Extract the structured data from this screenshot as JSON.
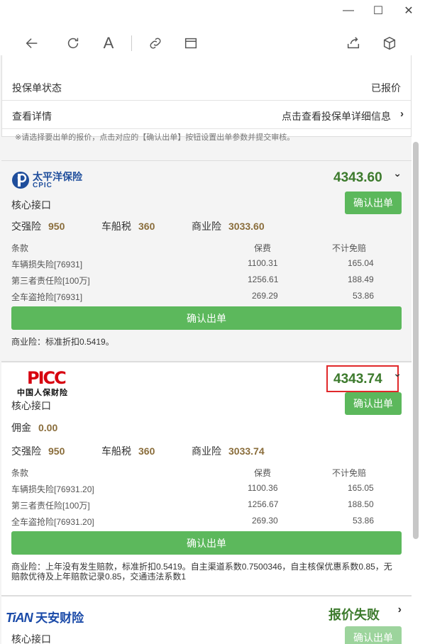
{
  "window": {
    "minimize": "—",
    "maximize": "☐",
    "close": "✕"
  },
  "toolbar": {
    "back_icon": "back-arrow-icon",
    "refresh_icon": "refresh-icon",
    "font_icon": "A",
    "link_icon": "link-icon",
    "window_icon": "window-icon",
    "share_icon": "share-icon",
    "extension_icon": "cube-icon"
  },
  "policy_info": {
    "rows": [
      {
        "label": "投保单状态",
        "value": "已报价"
      },
      {
        "label": "查看详情",
        "value": "点击查看投保单详细信息"
      }
    ],
    "note": "※请选择要出单的报价，点击对应的【确认出单】按钮设置出单参数并提交审核。"
  },
  "quotes": [
    {
      "company": "太平洋保险",
      "company_en": "CPIC",
      "total": "4343.60",
      "interface": "核心接口",
      "confirm_label": "确认出单",
      "taxes": [
        {
          "label": "交强险",
          "value": "950"
        },
        {
          "label": "车船税",
          "value": "360"
        },
        {
          "label": "商业险",
          "value": "3033.60"
        }
      ],
      "table_headers": [
        "条款",
        "保费",
        "不计免赔"
      ],
      "rows": [
        [
          "车辆损失险[76931]",
          "1100.31",
          "165.04"
        ],
        [
          "第三者责任险[100万]",
          "1256.61",
          "188.49"
        ],
        [
          "全车盗抢险[76931]",
          "269.29",
          "53.86"
        ]
      ],
      "confirm_wide_label": "确认出单",
      "remark": "商业险：标准折扣0.5419。"
    },
    {
      "company": "中国人保财险",
      "company_en": "PICC",
      "total": "4343.74",
      "interface": "核心接口",
      "confirm_label": "确认出单",
      "commission_label": "佣金",
      "commission_value": "0.00",
      "taxes": [
        {
          "label": "交强险",
          "value": "950"
        },
        {
          "label": "车船税",
          "value": "360"
        },
        {
          "label": "商业险",
          "value": "3033.74"
        }
      ],
      "table_headers": [
        "条款",
        "保费",
        "不计免赔"
      ],
      "rows": [
        [
          "车辆损失险[76931.20]",
          "1100.36",
          "165.05"
        ],
        [
          "第三者责任险[100万]",
          "1256.67",
          "188.50"
        ],
        [
          "全车盗抢险[76931.20]",
          "269.30",
          "53.86"
        ]
      ],
      "confirm_wide_label": "确认出单",
      "remark_line1": "商业险：上年没有发生赔款，标准折扣0.5419。自主渠道系数0.7500346，自主核保优惠系数0.85，无",
      "remark_line2": "赔款优待及上年赔款记录0.85，交通违法系数1"
    },
    {
      "company": "天安财险",
      "company_en": "TiAN",
      "status": "报价失败",
      "interface": "核心接口",
      "confirm_label": "确认出单"
    }
  ],
  "colors": {
    "accent_green": "#5cb85c",
    "price_green": "#3c7a2c",
    "gold": "#8a6d3b",
    "highlight_red": "#e0282a"
  }
}
